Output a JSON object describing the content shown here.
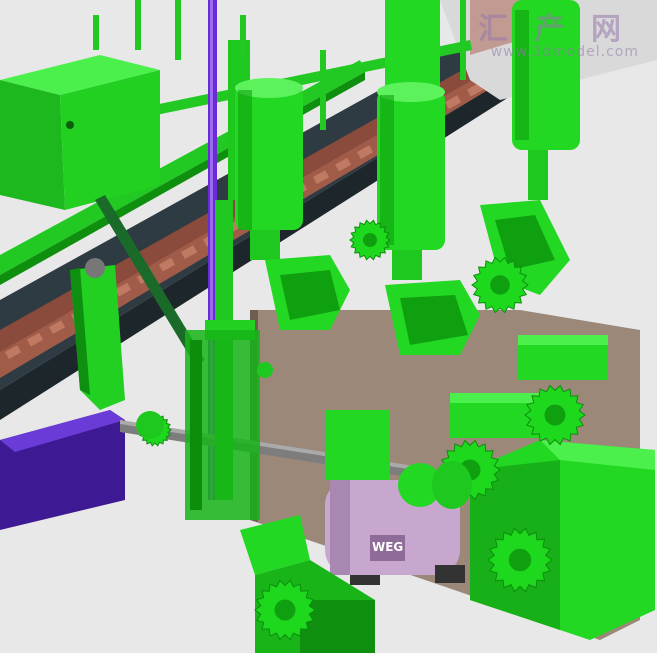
{
  "scene": {
    "kind": "3D CAD render of filling-machine drive assembly",
    "colors": {
      "background": "#e6e6e6",
      "parts_green": "#1ee01e",
      "parts_green_dark": "#0c8e0c",
      "frame_dark": "#27343a",
      "conveyor_chain": "#8b4b3c",
      "purple_rod": "#6a2bd6",
      "purple_block": "#4a1fa8",
      "plate_brown": "#9c8878",
      "motor_lilac": "#c8a7cf",
      "gray_shaft": "#777777"
    },
    "icons": [
      "watermark-logo"
    ]
  },
  "watermark": {
    "logo_text": "汇 产 网",
    "url_text": "www.3dmodel.com"
  },
  "motor": {
    "nameplate_text": "WEG"
  }
}
